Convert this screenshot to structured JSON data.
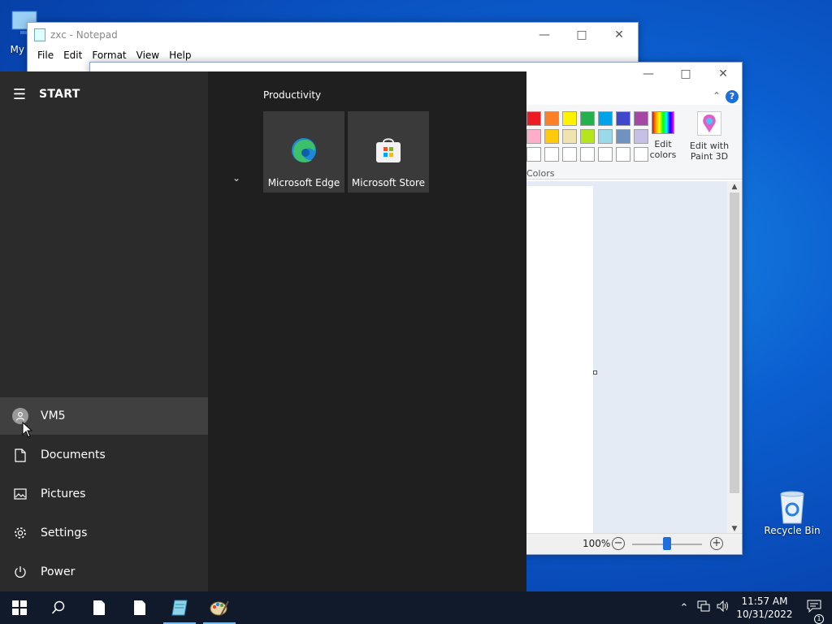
{
  "desktop": {
    "my_computer_label": "My Co",
    "recycle_bin_label": "Recycle Bin"
  },
  "notepad": {
    "title": "zxc - Notepad",
    "menu": [
      "File",
      "Edit",
      "Format",
      "View",
      "Help"
    ]
  },
  "paint": {
    "help": "?",
    "colors_group": "Colors",
    "edit_colors": "Edit colors",
    "edit_with_paint3d": "Edit with Paint 3D",
    "zoom": "100%",
    "zoom_level_percent": 100,
    "palette": [
      "#ed1c24",
      "#ff7f27",
      "#fff200",
      "#22b14c",
      "#00a2e8",
      "#3f48cc",
      "#a349a4",
      "#ffaec9",
      "#ffc90e",
      "#efe4b0",
      "#b5e61d",
      "#99d9ea",
      "#7092be",
      "#c8bfe7",
      "#ffffff",
      "#ffffff",
      "#ffffff",
      "#ffffff",
      "#ffffff",
      "#ffffff",
      "#ffffff"
    ]
  },
  "start_menu": {
    "title": "START",
    "group_title": "Productivity",
    "tiles": [
      {
        "label": "Microsoft Edge",
        "icon": "edge-icon"
      },
      {
        "label": "Microsoft Store",
        "icon": "store-icon"
      }
    ],
    "sidebar": [
      {
        "label": "VM5",
        "icon": "user-avatar-icon"
      },
      {
        "label": "Documents",
        "icon": "document-icon"
      },
      {
        "label": "Pictures",
        "icon": "pictures-icon"
      },
      {
        "label": "Settings",
        "icon": "gear-icon"
      },
      {
        "label": "Power",
        "icon": "power-icon"
      }
    ]
  },
  "taskbar": {
    "time": "11:57 AM",
    "date": "10/31/2022",
    "notification_count": "1",
    "accent_color": "#76b9ed"
  }
}
